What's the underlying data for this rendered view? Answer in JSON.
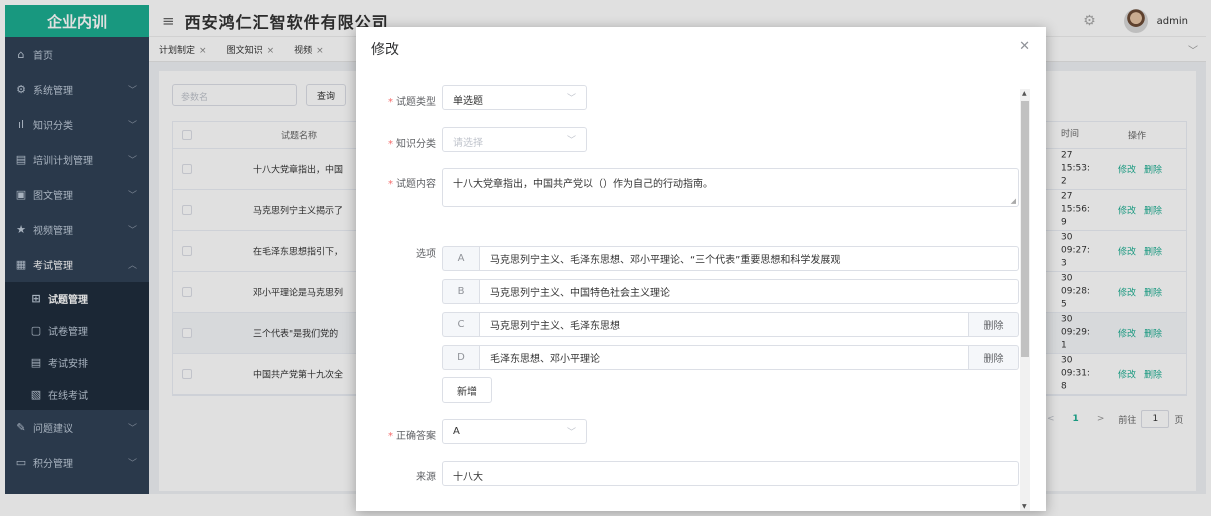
{
  "sidebar": {
    "brand": "企业内训",
    "items": [
      {
        "label": "首页",
        "icon": "home-icon"
      },
      {
        "label": "系统管理",
        "icon": "gear-icon"
      },
      {
        "label": "知识分类",
        "icon": "bar-chart-icon"
      },
      {
        "label": "培训计划管理",
        "icon": "clipboard-icon"
      },
      {
        "label": "图文管理",
        "icon": "picture-icon"
      },
      {
        "label": "视频管理",
        "icon": "star-icon"
      },
      {
        "label": "考试管理",
        "icon": "exam-icon"
      }
    ],
    "sub_items": [
      {
        "label": "试题管理",
        "icon": "grid-icon"
      },
      {
        "label": "试卷管理",
        "icon": "document-icon"
      },
      {
        "label": "考试安排",
        "icon": "schedule-icon"
      },
      {
        "label": "在线考试",
        "icon": "online-exam-icon"
      }
    ],
    "bottom_items": [
      {
        "label": "问题建议",
        "icon": "edit-icon"
      },
      {
        "label": "积分管理",
        "icon": "comment-icon"
      }
    ]
  },
  "header": {
    "title": "西安鸿仁汇智软件有限公司",
    "user": "admin"
  },
  "tags": [
    {
      "label": "计划制定"
    },
    {
      "label": "图文知识"
    },
    {
      "label": "视频"
    }
  ],
  "toolbar": {
    "search_placeholder": "参数名",
    "search_button": "查询"
  },
  "table": {
    "headers": {
      "name": "试题名称",
      "time": "时间",
      "op": "操作"
    },
    "op_edit": "修改",
    "op_delete": "删除",
    "rows": [
      {
        "name": "十八大党章指出，中国",
        "time_a": "27 15:53:",
        "time_b": "2"
      },
      {
        "name": "马克思列宁主义揭示了",
        "time_a": "27 15:56:",
        "time_b": "9"
      },
      {
        "name": "在毛泽东思想指引下，",
        "time_a": "30 09:27:",
        "time_b": "3"
      },
      {
        "name": "邓小平理论是马克思列",
        "time_a": "30 09:28:",
        "time_b": "5"
      },
      {
        "name": "三个代表\"是我们党的",
        "time_a": "30 09:29:",
        "time_b": "1"
      },
      {
        "name": "中国共产党第十九次全",
        "time_a": "30 09:31:",
        "time_b": "8"
      }
    ]
  },
  "pager": {
    "prev": "<",
    "page": "1",
    "next": ">",
    "goto_label": "前往",
    "goto_value": "1",
    "page_suffix": "页"
  },
  "dialog": {
    "title": "修改",
    "type_label": "试题类型",
    "type_value": "单选题",
    "category_label": "知识分类",
    "category_placeholder": "请选择",
    "content_label": "试题内容",
    "content_value": "十八大党章指出，中国共产党以（）作为自己的行动指南。",
    "options_label": "选项",
    "options": [
      {
        "letter": "A",
        "text": "马克思列宁主义、毛泽东思想、邓小平理论、“三个代表”重要思想和科学发展观"
      },
      {
        "letter": "B",
        "text": "马克思列宁主义、中国特色社会主义理论"
      },
      {
        "letter": "C",
        "text": "马克思列宁主义、毛泽东思想",
        "delete": "删除"
      },
      {
        "letter": "D",
        "text": "毛泽东思想、邓小平理论",
        "delete": "删除"
      }
    ],
    "add_button": "新增",
    "answer_label": "正确答案",
    "answer_value": "A",
    "source_label": "来源",
    "source_value": "十八大"
  },
  "colors": {
    "sidebar_bg": "#304156",
    "brand_bg": "#1cae91",
    "accent": "#1cae91",
    "required": "#f56c6c"
  }
}
